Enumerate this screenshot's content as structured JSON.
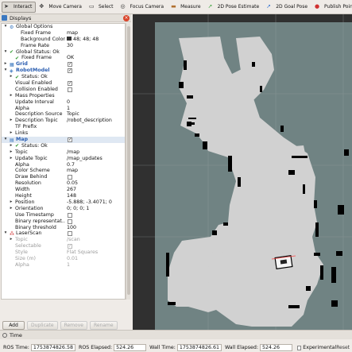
{
  "toolbar": {
    "tools": [
      {
        "label": "Interact",
        "icon": "interact-icon",
        "active": true
      },
      {
        "label": "Move Camera",
        "icon": "move-camera-icon"
      },
      {
        "label": "Select",
        "icon": "select-icon"
      },
      {
        "label": "Focus Camera",
        "icon": "focus-camera-icon"
      },
      {
        "label": "Measure",
        "icon": "measure-icon"
      },
      {
        "label": "2D Pose Estimate",
        "icon": "pose-estimate-icon"
      },
      {
        "label": "2D Goal Pose",
        "icon": "goal-pose-icon"
      },
      {
        "label": "Publish Point",
        "icon": "publish-point-icon"
      }
    ]
  },
  "displays": {
    "title": "Displays",
    "rows": [
      {
        "label": "Global Options",
        "indent": 0,
        "arrow": "▾",
        "icon": "gear"
      },
      {
        "label": "Fixed Frame",
        "value": "map",
        "indent": 2
      },
      {
        "label": "Background Color",
        "value": "48; 48; 48",
        "indent": 2,
        "swatch": "#303030"
      },
      {
        "label": "Frame Rate",
        "value": "30",
        "indent": 2
      },
      {
        "label": "Global Status: Ok",
        "indent": 0,
        "arrow": "▾",
        "icon": "check"
      },
      {
        "label": "Fixed Frame",
        "value": "OK",
        "indent": 1,
        "icon": "check"
      },
      {
        "label": "Grid",
        "indent": 0,
        "arrow": "▸",
        "icon": "grid",
        "check": true,
        "blue": true
      },
      {
        "label": "RobotModel",
        "indent": 0,
        "arrow": "▾",
        "icon": "robot",
        "check": true,
        "blue": true
      },
      {
        "label": "Status: Ok",
        "indent": 1,
        "arrow": "▸",
        "icon": "check"
      },
      {
        "label": "Visual Enabled",
        "indent": 1,
        "check": true
      },
      {
        "label": "Collision Enabled",
        "indent": 1,
        "check": false
      },
      {
        "label": "Mass Properties",
        "indent": 1,
        "arrow": "▸"
      },
      {
        "label": "Update Interval",
        "value": "0",
        "indent": 1
      },
      {
        "label": "Alpha",
        "value": "1",
        "indent": 1
      },
      {
        "label": "Description Source",
        "value": "Topic",
        "indent": 1
      },
      {
        "label": "Description Topic",
        "value": "/robot_description",
        "indent": 1,
        "arrow": "▸"
      },
      {
        "label": "TF Prefix",
        "indent": 1
      },
      {
        "label": "Links",
        "indent": 1,
        "arrow": "▸"
      },
      {
        "label": "Map",
        "indent": 0,
        "arrow": "▾",
        "icon": "map",
        "check": true,
        "blue": true,
        "selected": true
      },
      {
        "label": "Status: Ok",
        "indent": 1,
        "arrow": "▸",
        "icon": "check"
      },
      {
        "label": "Topic",
        "value": "/map",
        "indent": 1,
        "arrow": "▸"
      },
      {
        "label": "Update Topic",
        "value": "/map_updates",
        "indent": 1,
        "arrow": "▸"
      },
      {
        "label": "Alpha",
        "value": "0.7",
        "indent": 1
      },
      {
        "label": "Color Scheme",
        "value": "map",
        "indent": 1
      },
      {
        "label": "Draw Behind",
        "indent": 1,
        "check": false
      },
      {
        "label": "Resolution",
        "value": "0.05",
        "indent": 1
      },
      {
        "label": "Width",
        "value": "267",
        "indent": 1
      },
      {
        "label": "Height",
        "value": "148",
        "indent": 1
      },
      {
        "label": "Position",
        "value": "-5.888; -3.4071; 0",
        "indent": 1,
        "arrow": "▸"
      },
      {
        "label": "Orientation",
        "value": "0; 0; 0; 1",
        "indent": 1,
        "arrow": "▸"
      },
      {
        "label": "Use Timestamp",
        "indent": 1,
        "check": false
      },
      {
        "label": "Binary representat...",
        "indent": 1,
        "check": false
      },
      {
        "label": "Binary threshold",
        "value": "100",
        "indent": 1
      },
      {
        "label": "LaserScan",
        "indent": 0,
        "arrow": "▾",
        "icon": "laser",
        "check": false
      },
      {
        "label": "Topic",
        "value": "/scan",
        "indent": 1,
        "arrow": "▸",
        "disabled": true
      },
      {
        "label": "Selectable",
        "indent": 1,
        "check": true,
        "disabled": true
      },
      {
        "label": "Style",
        "value": "Flat Squares",
        "indent": 1,
        "disabled": true
      },
      {
        "label": "Size (m)",
        "value": "0.01",
        "indent": 1,
        "disabled": true
      },
      {
        "label": "Alpha",
        "value": "1",
        "indent": 1,
        "disabled": true
      }
    ],
    "buttons": [
      {
        "label": "Add",
        "enabled": true
      },
      {
        "label": "Duplicate",
        "enabled": false
      },
      {
        "label": "Remove",
        "enabled": false
      },
      {
        "label": "Rename",
        "enabled": false
      }
    ]
  },
  "time": {
    "title": "Time",
    "ros_time_label": "ROS Time:",
    "ros_time": "1753874826.58",
    "ros_elapsed_label": "ROS Elapsed:",
    "ros_elapsed": "524.26",
    "wall_time_label": "Wall Time:",
    "wall_time": "1753874826.61",
    "wall_elapsed_label": "Wall Elapsed:",
    "wall_elapsed": "524.26",
    "experimental_label": "Experimental",
    "reset_label": "Reset"
  },
  "colors": {
    "viewport_background": "#303030",
    "map_unknown": "#708383",
    "map_free": "#d1d1d1",
    "map_occupied": "#000000",
    "grid_line": "#a0a0a0"
  }
}
